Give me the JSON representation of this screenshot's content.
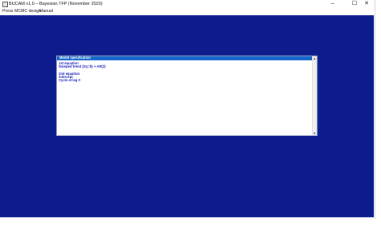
{
  "window": {
    "title": "BUCAM v1.0 – Bayesian TFP (November 2020)",
    "controls": {
      "minimize": "–",
      "maximize": "☐",
      "close": "✕"
    }
  },
  "menu": {
    "items": [
      "Press",
      "MCMC design",
      "Manual"
    ]
  },
  "colors": {
    "workspace": "#0c1c8c",
    "dialog_header": "#1566c8",
    "spec_text": "#1a22b8"
  },
  "dialog": {
    "title": "Model specification",
    "lines": [
      "1st equation",
      "Damped trend (Gy=b) + AR(2)",
      "",
      "2nd equation",
      "Intercept",
      "Cycle at lag 0"
    ]
  }
}
